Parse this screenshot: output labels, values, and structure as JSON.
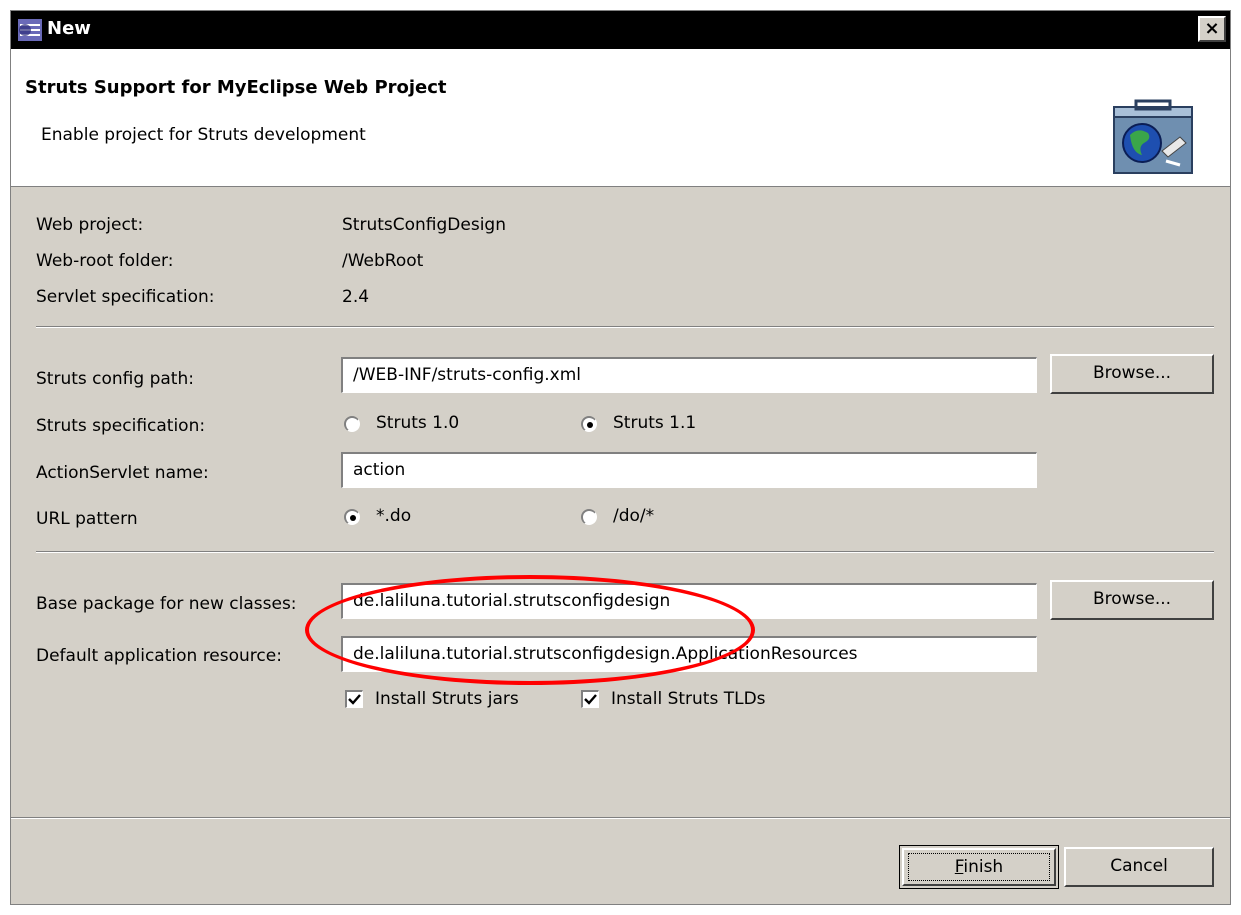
{
  "window": {
    "title": "New",
    "close_label": "×"
  },
  "banner": {
    "heading": "Struts Support for MyEclipse Web Project",
    "description": "Enable project for Struts development",
    "icon": "globe-wizard-icon"
  },
  "project_info": {
    "web_project_label": "Web project:",
    "web_project_value": "StrutsConfigDesign",
    "web_root_label": "Web-root folder:",
    "web_root_value": "/WebRoot",
    "servlet_spec_label": "Servlet specification:",
    "servlet_spec_value": "2.4"
  },
  "struts_config": {
    "config_path_label": "Struts config path:",
    "config_path_value": "/WEB-INF/struts-config.xml",
    "browse_label": "Browse...",
    "spec_label": "Struts specification:",
    "spec_options": [
      "Struts 1.0",
      "Struts 1.1"
    ],
    "spec_selected": "Struts 1.1",
    "servlet_name_label": "ActionServlet name:",
    "servlet_name_value": "action",
    "url_pattern_label": "URL pattern",
    "url_pattern_options": [
      "*.do",
      "/do/*"
    ],
    "url_pattern_selected": "*.do"
  },
  "packages": {
    "base_package_label": "Base package for new classes:",
    "base_package_value": "de.laliluna.tutorial.strutsconfigdesign",
    "browse_label": "Browse...",
    "default_resource_label": "Default application resource:",
    "default_resource_value": "de.laliluna.tutorial.strutsconfigdesign.ApplicationResources",
    "install_jars_label": "Install Struts jars",
    "install_jars_checked": true,
    "install_tlds_label": "Install Struts TLDs",
    "install_tlds_checked": true
  },
  "footer": {
    "finish_label": "Finish",
    "finish_mnemonic": "F",
    "finish_rest": "inish",
    "cancel_label": "Cancel"
  },
  "annotation": {
    "color": "#ff0000"
  }
}
